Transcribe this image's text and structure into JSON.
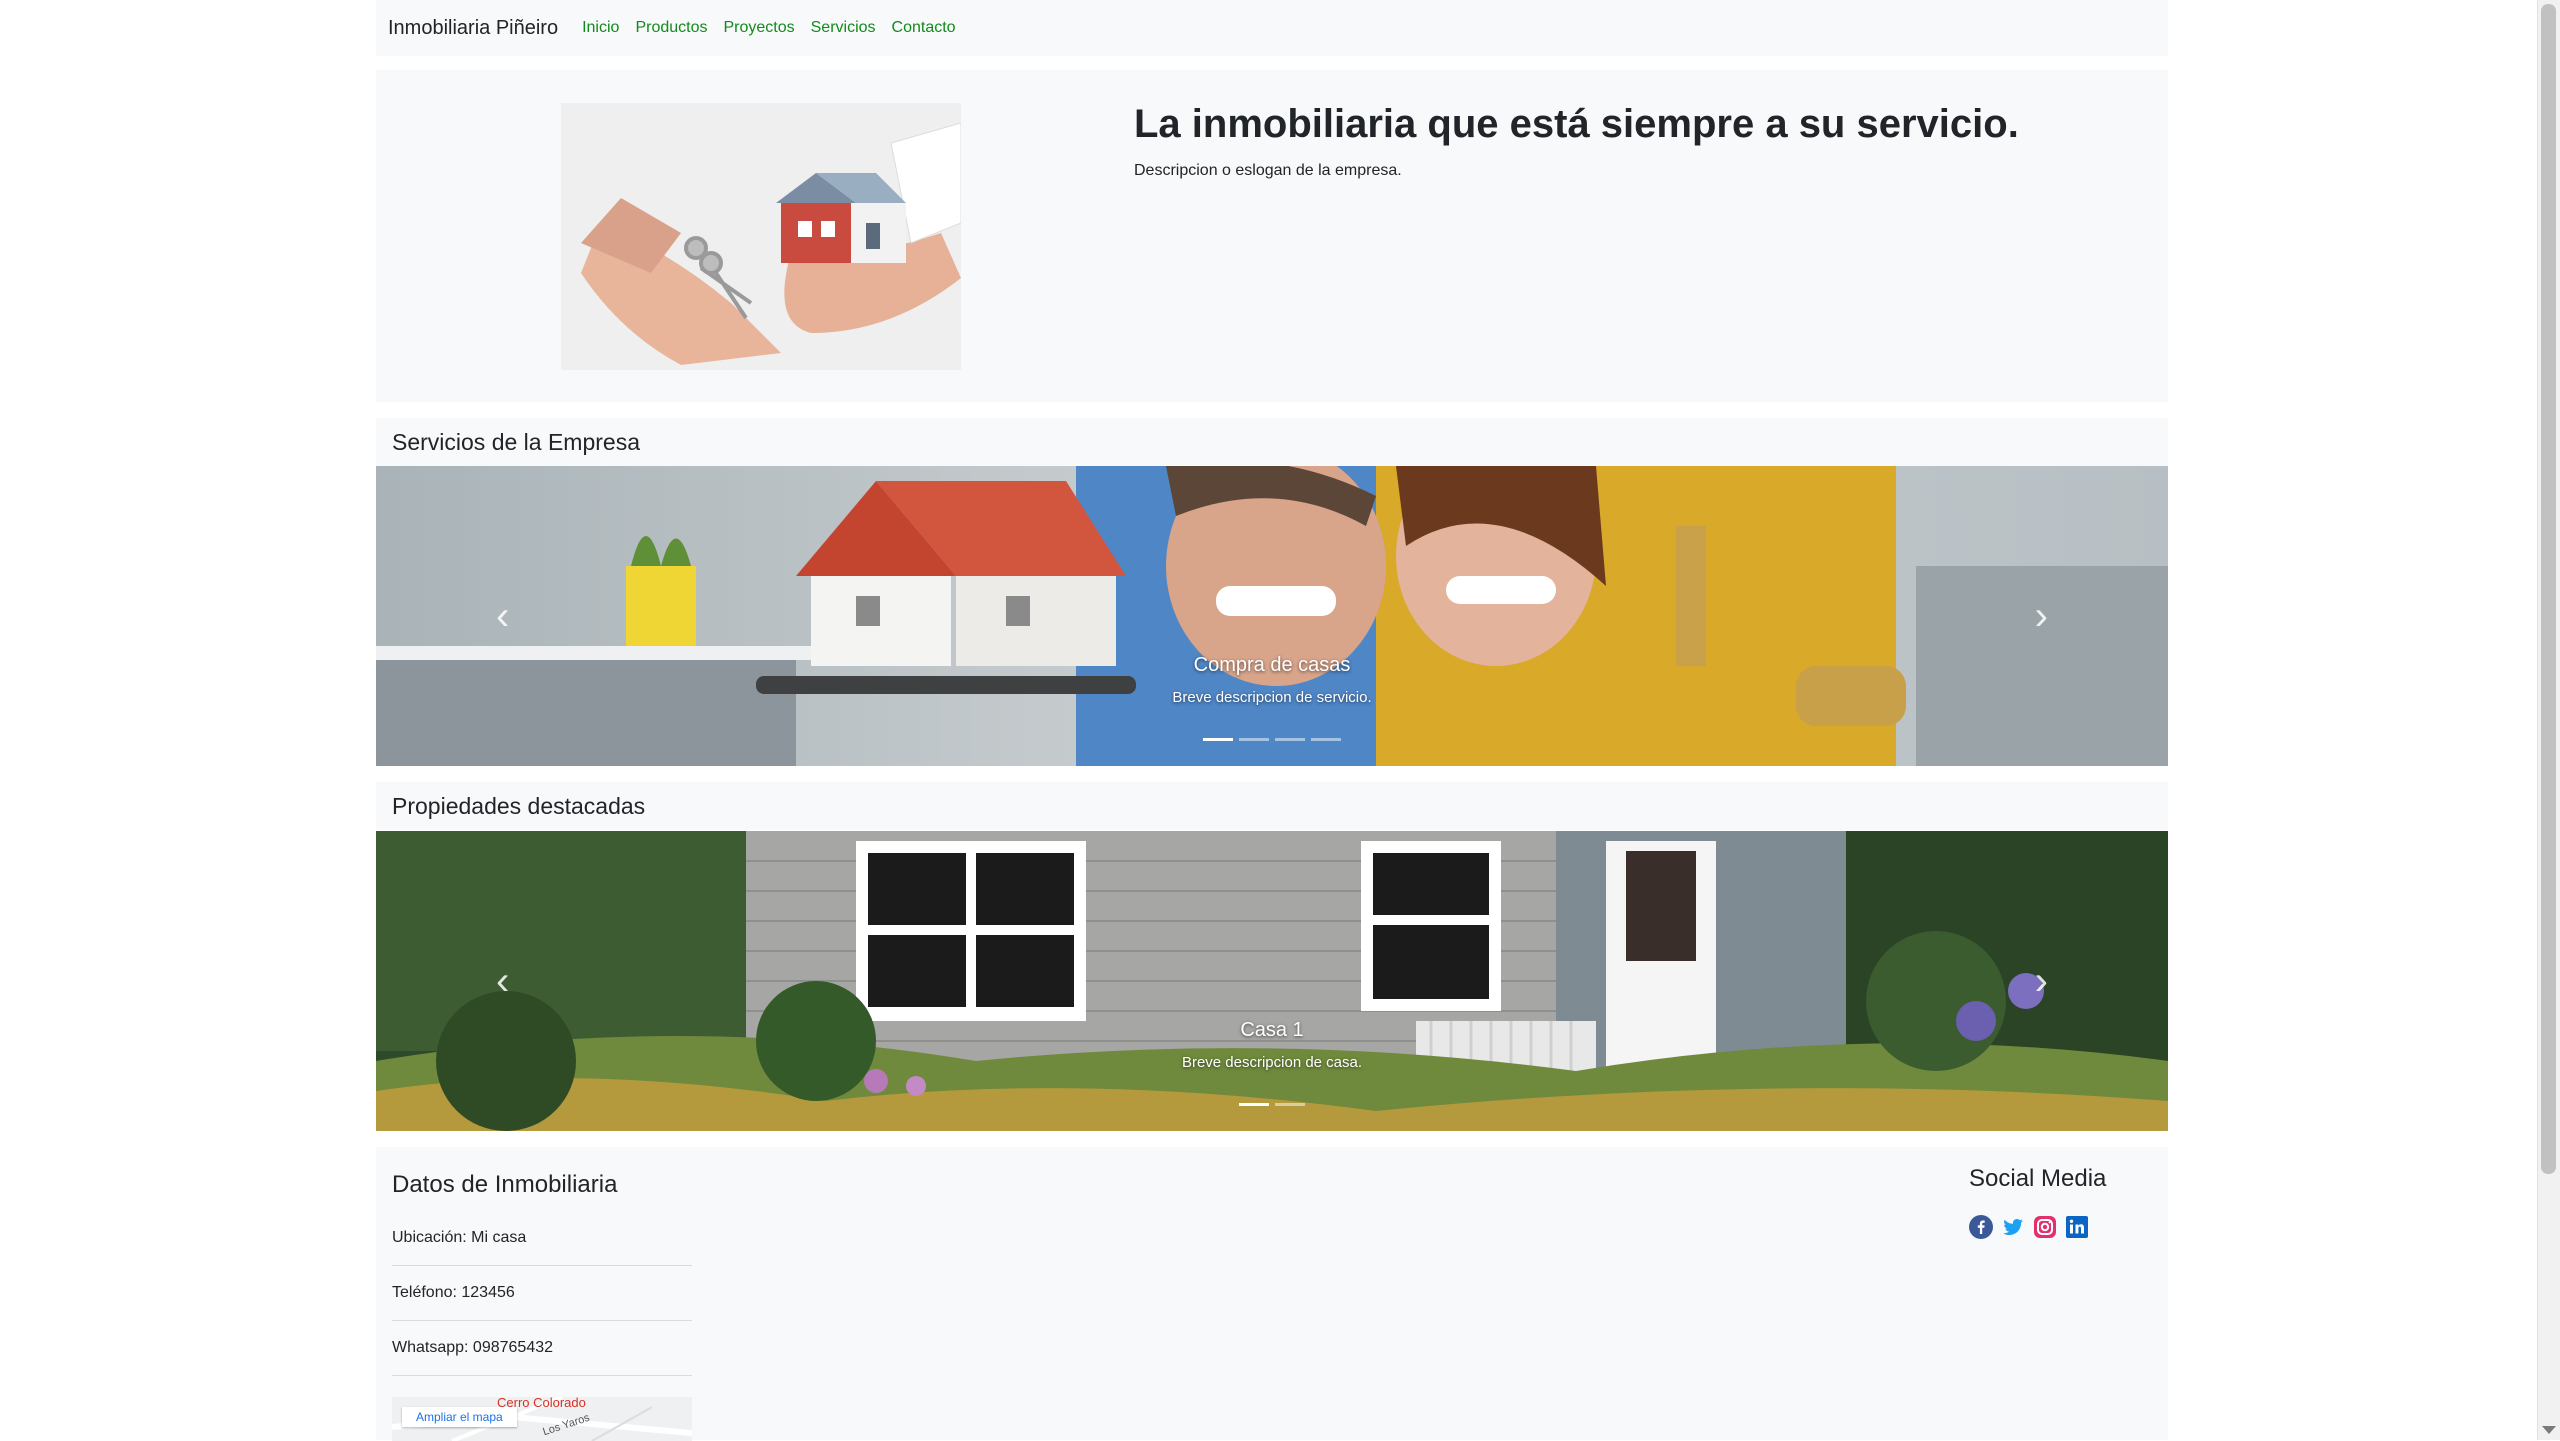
{
  "navbar": {
    "brand": "Inmobiliaria Piñeiro",
    "links": [
      "Inicio",
      "Productos",
      "Proyectos",
      "Servicios",
      "Contacto"
    ]
  },
  "hero": {
    "title": "La inmobiliaria que está siempre a su servicio.",
    "description": "Descripcion o eslogan de la empresa."
  },
  "services": {
    "heading": "Servicios de la Empresa",
    "slide_title": "Compra de casas",
    "slide_desc": "Breve descripcion de servicio.",
    "indicator_count": 4,
    "active_indicator": 1
  },
  "properties": {
    "heading": "Propiedades destacadas",
    "slide_title": "Casa 1",
    "slide_desc": "Breve descripcion de casa.",
    "indicator_count": 2,
    "active_indicator": 1
  },
  "footer": {
    "heading": "Datos de Inmobiliaria",
    "ubicacion": "Ubicación: Mi casa",
    "telefono": "Teléfono: 123456",
    "whatsapp": "Whatsapp: 098765432",
    "map_button": "Ampliar el mapa",
    "map_place": "Cerro Colorado",
    "map_road": "Los Yaros",
    "social_heading": "Social Media",
    "social_icons": [
      "facebook-icon",
      "twitter-icon",
      "instagram-icon",
      "linkedin-icon"
    ]
  },
  "colors": {
    "link": "#138a1c",
    "panel": "#f8f9fa",
    "facebook": "#3b5998",
    "twitter": "#1da1f2",
    "instagram": "#e1306c",
    "linkedin": "#0a66c2"
  }
}
